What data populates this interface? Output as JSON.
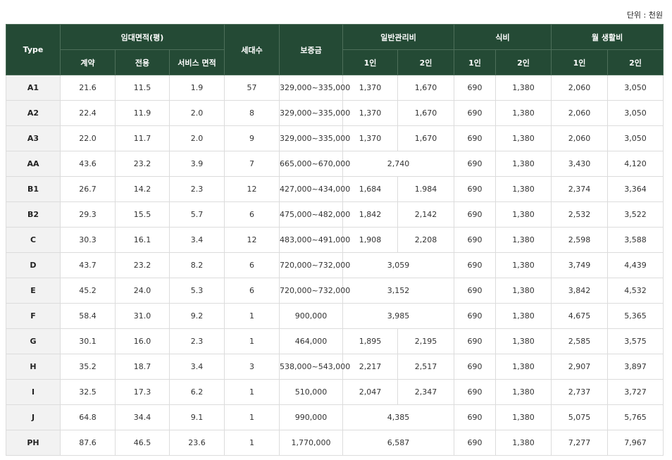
{
  "unit_label": "단위 : 천원",
  "header": {
    "type": "Type",
    "lease_area": "임대면적(평)",
    "contract": "계약",
    "exclusive": "전용",
    "service_area": "서비스 면적",
    "households": "세대수",
    "deposit": "보증금",
    "general_mgmt": "일반관리비",
    "meals": "식비",
    "monthly_living": "월 생활비",
    "one_person": "1인",
    "two_person": "2인"
  },
  "rows": [
    {
      "type": "A1",
      "contract": "21.6",
      "exclusive": "11.5",
      "service": "1.9",
      "households": "57",
      "deposit": "329,000~335,000",
      "mgmt1": "1,370",
      "mgmt2": "1,670",
      "meal1": "690",
      "meal2": "1,380",
      "living1": "2,060",
      "living2": "3,050"
    },
    {
      "type": "A2",
      "contract": "22.4",
      "exclusive": "11.9",
      "service": "2.0",
      "households": "8",
      "deposit": "329,000~335,000",
      "mgmt1": "1,370",
      "mgmt2": "1,670",
      "meal1": "690",
      "meal2": "1,380",
      "living1": "2,060",
      "living2": "3,050"
    },
    {
      "type": "A3",
      "contract": "22.0",
      "exclusive": "11.7",
      "service": "2.0",
      "households": "9",
      "deposit": "329,000~335,000",
      "mgmt1": "1,370",
      "mgmt2": "1,670",
      "meal1": "690",
      "meal2": "1,380",
      "living1": "2,060",
      "living2": "3,050"
    },
    {
      "type": "AA",
      "contract": "43.6",
      "exclusive": "23.2",
      "service": "3.9",
      "households": "7",
      "deposit": "665,000~670,000",
      "mgmt": "2,740",
      "meal1": "690",
      "meal2": "1,380",
      "living1": "3,430",
      "living2": "4,120"
    },
    {
      "type": "B1",
      "contract": "26.7",
      "exclusive": "14.2",
      "service": "2.3",
      "households": "12",
      "deposit": "427,000~434,000",
      "mgmt1": "1,684",
      "mgmt2": "1.984",
      "meal1": "690",
      "meal2": "1,380",
      "living1": "2,374",
      "living2": "3,364"
    },
    {
      "type": "B2",
      "contract": "29.3",
      "exclusive": "15.5",
      "service": "5.7",
      "households": "6",
      "deposit": "475,000~482,000",
      "mgmt1": "1,842",
      "mgmt2": "2,142",
      "meal1": "690",
      "meal2": "1,380",
      "living1": "2,532",
      "living2": "3,522"
    },
    {
      "type": "C",
      "contract": "30.3",
      "exclusive": "16.1",
      "service": "3.4",
      "households": "12",
      "deposit": "483,000~491,000",
      "mgmt1": "1,908",
      "mgmt2": "2,208",
      "meal1": "690",
      "meal2": "1,380",
      "living1": "2,598",
      "living2": "3,588"
    },
    {
      "type": "D",
      "contract": "43.7",
      "exclusive": "23.2",
      "service": "8.2",
      "households": "6",
      "deposit": "720,000~732,000",
      "mgmt": "3,059",
      "meal1": "690",
      "meal2": "1,380",
      "living1": "3,749",
      "living2": "4,439"
    },
    {
      "type": "E",
      "contract": "45.2",
      "exclusive": "24.0",
      "service": "5.3",
      "households": "6",
      "deposit": "720,000~732,000",
      "mgmt": "3,152",
      "meal1": "690",
      "meal2": "1,380",
      "living1": "3,842",
      "living2": "4,532"
    },
    {
      "type": "F",
      "contract": "58.4",
      "exclusive": "31.0",
      "service": "9.2",
      "households": "1",
      "deposit": "900,000",
      "mgmt": "3,985",
      "meal1": "690",
      "meal2": "1,380",
      "living1": "4,675",
      "living2": "5,365"
    },
    {
      "type": "G",
      "contract": "30.1",
      "exclusive": "16.0",
      "service": "2.3",
      "households": "1",
      "deposit": "464,000",
      "mgmt1": "1,895",
      "mgmt2": "2,195",
      "meal1": "690",
      "meal2": "1,380",
      "living1": "2,585",
      "living2": "3,575"
    },
    {
      "type": "H",
      "contract": "35.2",
      "exclusive": "18.7",
      "service": "3.4",
      "households": "3",
      "deposit": "538,000~543,000",
      "mgmt1": "2,217",
      "mgmt2": "2,517",
      "meal1": "690",
      "meal2": "1,380",
      "living1": "2,907",
      "living2": "3,897"
    },
    {
      "type": "I",
      "contract": "32.5",
      "exclusive": "17.3",
      "service": "6.2",
      "households": "1",
      "deposit": "510,000",
      "mgmt1": "2,047",
      "mgmt2": "2,347",
      "meal1": "690",
      "meal2": "1,380",
      "living1": "2,737",
      "living2": "3,727"
    },
    {
      "type": "J",
      "contract": "64.8",
      "exclusive": "34.4",
      "service": "9.1",
      "households": "1",
      "deposit": "990,000",
      "mgmt": "4,385",
      "meal1": "690",
      "meal2": "1,380",
      "living1": "5,075",
      "living2": "5,765"
    },
    {
      "type": "PH",
      "contract": "87.6",
      "exclusive": "46.5",
      "service": "23.6",
      "households": "1",
      "deposit": "1,770,000",
      "mgmt": "6,587",
      "meal1": "690",
      "meal2": "1,380",
      "living1": "7,277",
      "living2": "7,967"
    }
  ]
}
